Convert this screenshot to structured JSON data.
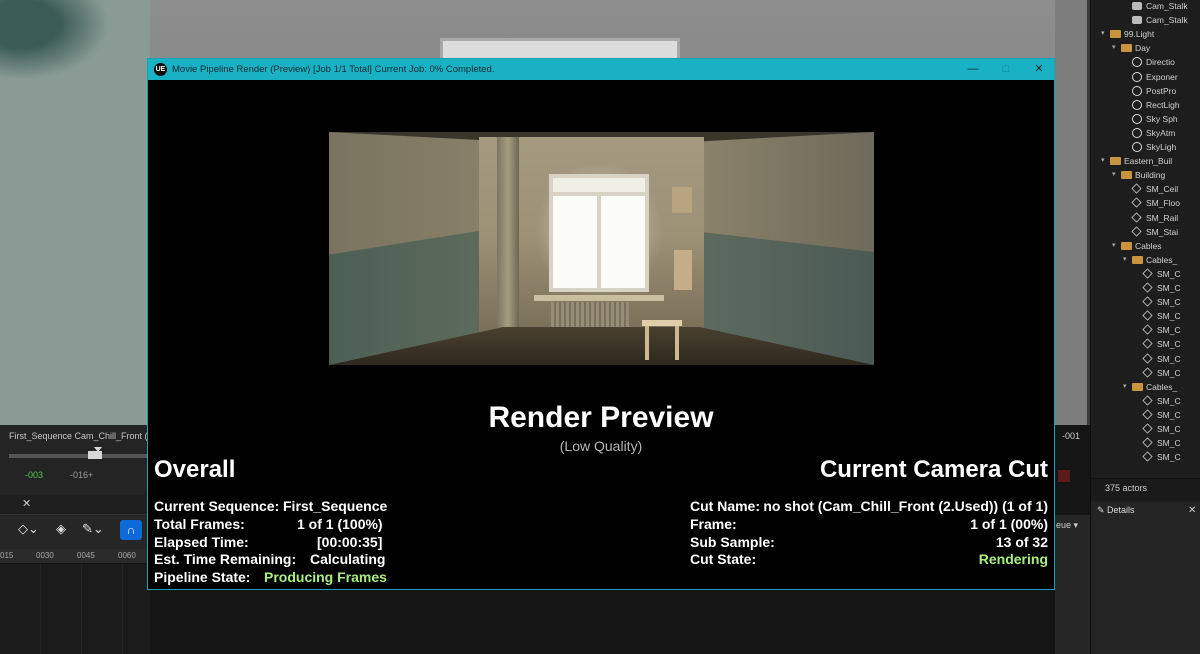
{
  "dialog": {
    "title": "Movie Pipeline Render (Preview) [Job 1/1 Total] Current Job: 0% Completed.",
    "logo": "UE",
    "minimize": "—",
    "maximize": "□",
    "close": "✕",
    "render_title": "Render Preview",
    "render_subtitle": "(Low Quality)",
    "overall": {
      "heading": "Overall",
      "rows": [
        {
          "label": "Current Sequence:",
          "value": "First_Sequence"
        },
        {
          "label": "Total Frames:",
          "value": "1 of 1 (100%)"
        },
        {
          "label": "Elapsed Time:",
          "value": "[00:00:35]"
        },
        {
          "label": "Est. Time Remaining:",
          "value": "Calculating"
        },
        {
          "label": "Pipeline State:",
          "value": "Producing Frames"
        }
      ]
    },
    "camera_cut": {
      "heading": "Current Camera Cut",
      "rows": [
        {
          "label": "Cut Name:",
          "value": "no shot (Cam_Chill_Front (2.Used)) (1 of 1)"
        },
        {
          "label": "Frame:",
          "value": "1 of 1 (00%)"
        },
        {
          "label": "Sub Sample:",
          "value": "13 of 32"
        },
        {
          "label": "Cut State:",
          "value": "Rendering"
        }
      ]
    },
    "accent_color": "#19b1c4",
    "status_color": "#a9ef7f"
  },
  "sequencer": {
    "label": "First_Sequence  Cam_Chill_Front (",
    "time_start": "-003",
    "time_mid": "-016+",
    "right_frame": "-001",
    "right_tab": "eue ▾",
    "close": "✕",
    "ruler": [
      "015",
      "0030",
      "0045",
      "0060"
    ],
    "tools": [
      "◇⌄",
      "◈",
      "✎⌄"
    ],
    "magnet": "∩"
  },
  "outliner": {
    "items": [
      {
        "label": "Cam_Stalk",
        "indent": 3,
        "icon": "camera"
      },
      {
        "label": "Cam_Stalk",
        "indent": 3,
        "icon": "camera"
      },
      {
        "label": "99.Light",
        "indent": 1,
        "icon": "folder",
        "arrow": "▾"
      },
      {
        "label": "Day",
        "indent": 2,
        "icon": "folder",
        "arrow": "▾"
      },
      {
        "label": "Directio",
        "indent": 3,
        "icon": "light"
      },
      {
        "label": "Exponer",
        "indent": 3,
        "icon": "light"
      },
      {
        "label": "PostPro",
        "indent": 3,
        "icon": "light"
      },
      {
        "label": "RectLigh",
        "indent": 3,
        "icon": "light"
      },
      {
        "label": "Sky Sph",
        "indent": 3,
        "icon": "light"
      },
      {
        "label": "SkyAtm",
        "indent": 3,
        "icon": "light"
      },
      {
        "label": "SkyLigh",
        "indent": 3,
        "icon": "light"
      },
      {
        "label": "Eastern_Buil",
        "indent": 1,
        "icon": "folder",
        "arrow": "▾"
      },
      {
        "label": "Building",
        "indent": 2,
        "icon": "folder",
        "arrow": "▾"
      },
      {
        "label": "SM_Ceil",
        "indent": 3,
        "icon": "actor"
      },
      {
        "label": "SM_Floo",
        "indent": 3,
        "icon": "actor"
      },
      {
        "label": "SM_Rail",
        "indent": 3,
        "icon": "actor"
      },
      {
        "label": "SM_Stai",
        "indent": 3,
        "icon": "actor"
      },
      {
        "label": "Cables",
        "indent": 2,
        "icon": "folder",
        "arrow": "▾"
      },
      {
        "label": "Cables_",
        "indent": 3,
        "icon": "folder",
        "arrow": "▾"
      },
      {
        "label": "SM_C",
        "indent": 4,
        "icon": "actor"
      },
      {
        "label": "SM_C",
        "indent": 4,
        "icon": "actor"
      },
      {
        "label": "SM_C",
        "indent": 4,
        "icon": "actor"
      },
      {
        "label": "SM_C",
        "indent": 4,
        "icon": "actor"
      },
      {
        "label": "SM_C",
        "indent": 4,
        "icon": "actor"
      },
      {
        "label": "SM_C",
        "indent": 4,
        "icon": "actor"
      },
      {
        "label": "SM_C",
        "indent": 4,
        "icon": "actor"
      },
      {
        "label": "SM_C",
        "indent": 4,
        "icon": "actor"
      },
      {
        "label": "Cables_",
        "indent": 3,
        "icon": "folder",
        "arrow": "▾"
      },
      {
        "label": "SM_C",
        "indent": 4,
        "icon": "actor"
      },
      {
        "label": "SM_C",
        "indent": 4,
        "icon": "actor"
      },
      {
        "label": "SM_C",
        "indent": 4,
        "icon": "actor"
      },
      {
        "label": "SM_C",
        "indent": 4,
        "icon": "actor"
      },
      {
        "label": "SM_C",
        "indent": 4,
        "icon": "actor"
      }
    ],
    "actor_count": "375 actors",
    "details_tab": "Details",
    "details_close": "✕"
  }
}
